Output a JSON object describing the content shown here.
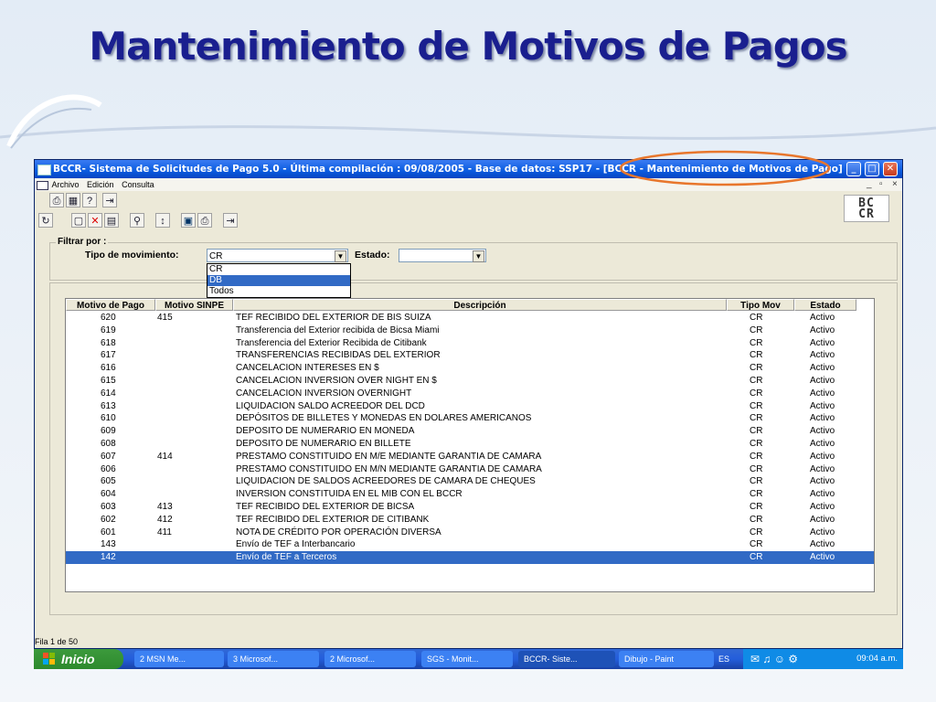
{
  "slide": {
    "title": "Mantenimiento de Motivos de Pagos"
  },
  "window": {
    "title": "BCCR- Sistema de Solicitudes de Pago 5.0 - Última compilación : 09/08/2005 - Base de datos: SSP17 - [BCCR - Mantenimiento de Motivos de Pago]",
    "min": "_",
    "max": "□",
    "close": "✕"
  },
  "menu": {
    "items": [
      "Archivo",
      "Edición",
      "Consulta"
    ],
    "mdi": [
      "_",
      "▫",
      "×"
    ]
  },
  "logo": {
    "text": "BCCR"
  },
  "filter": {
    "legend": "Filtrar por :",
    "tipo_label": "Tipo de movimiento:",
    "tipo_value": "CR",
    "estado_label": "Estado:",
    "estado_value": "",
    "options": [
      "CR",
      "DB",
      "Todos"
    ],
    "highlighted_option": "DB"
  },
  "grid": {
    "columns": [
      "Motivo de Pago",
      "Motivo SINPE",
      "Descripción",
      "Tipo Mov",
      "Estado"
    ],
    "rows": [
      [
        "620",
        "415",
        "TEF RECIBIDO DEL EXTERIOR DE BIS SUIZA",
        "CR",
        "Activo"
      ],
      [
        "619",
        "",
        "Transferencia del Exterior recibida de Bicsa Miami",
        "CR",
        "Activo"
      ],
      [
        "618",
        "",
        "Transferencia del Exterior Recibida de Citibank",
        "CR",
        "Activo"
      ],
      [
        "617",
        "",
        "TRANSFERENCIAS RECIBIDAS DEL EXTERIOR",
        "CR",
        "Activo"
      ],
      [
        "616",
        "",
        "CANCELACION INTERESES EN $",
        "CR",
        "Activo"
      ],
      [
        "615",
        "",
        "CANCELACION INVERSION OVER NIGHT EN $",
        "CR",
        "Activo"
      ],
      [
        "614",
        "",
        "CANCELACION INVERSION OVERNIGHT",
        "CR",
        "Activo"
      ],
      [
        "613",
        "",
        "LIQUIDACION SALDO ACREEDOR DEL DCD",
        "CR",
        "Activo"
      ],
      [
        "610",
        "",
        "DEPÓSITOS DE BILLETES Y MONEDAS EN DOLARES AMERICANOS",
        "CR",
        "Activo"
      ],
      [
        "609",
        "",
        "DEPOSITO DE NUMERARIO EN MONEDA",
        "CR",
        "Activo"
      ],
      [
        "608",
        "",
        "DEPOSITO DE NUMERARIO EN BILLETE",
        "CR",
        "Activo"
      ],
      [
        "607",
        "414",
        "PRESTAMO CONSTITUIDO EN M/E MEDIANTE GARANTIA DE CAMARA",
        "CR",
        "Activo"
      ],
      [
        "606",
        "",
        "PRESTAMO CONSTITUIDO EN M/N MEDIANTE GARANTIA DE CAMARA",
        "CR",
        "Activo"
      ],
      [
        "605",
        "",
        "LIQUIDACION DE SALDOS ACREEDORES DE CAMARA DE CHEQUES",
        "CR",
        "Activo"
      ],
      [
        "604",
        "",
        "INVERSION CONSTITUIDA EN EL MIB CON EL BCCR",
        "CR",
        "Activo"
      ],
      [
        "603",
        "413",
        "TEF  RECIBIDO DEL EXTERIOR DE BICSA",
        "CR",
        "Activo"
      ],
      [
        "602",
        "412",
        "TEF RECIBIDO DEL EXTERIOR  DE CITIBANK",
        "CR",
        "Activo"
      ],
      [
        "601",
        "411",
        "NOTA DE CRÉDITO POR OPERACIÓN DIVERSA",
        "CR",
        "Activo"
      ],
      [
        "143",
        "",
        "Envío de TEF a Interbancario",
        "CR",
        "Activo"
      ],
      [
        "142",
        "",
        "Envío de TEF a Terceros",
        "CR",
        "Activo"
      ]
    ],
    "selected_row": 19
  },
  "status": {
    "text": "Fila 1 de 50"
  },
  "taskbar": {
    "start": "Inicio",
    "tasks": [
      "2 MSN Me...",
      "3 Microsof...",
      "2 Microsof...",
      "SGS - Monit...",
      "BCCR- Siste...",
      "Dibujo - Paint"
    ],
    "lang": "ES",
    "clock": "09:04 a.m."
  },
  "colors": {
    "title": "#1a1f8f",
    "selection": "#316ac5",
    "highlight_ellipse": "#e8762c"
  }
}
